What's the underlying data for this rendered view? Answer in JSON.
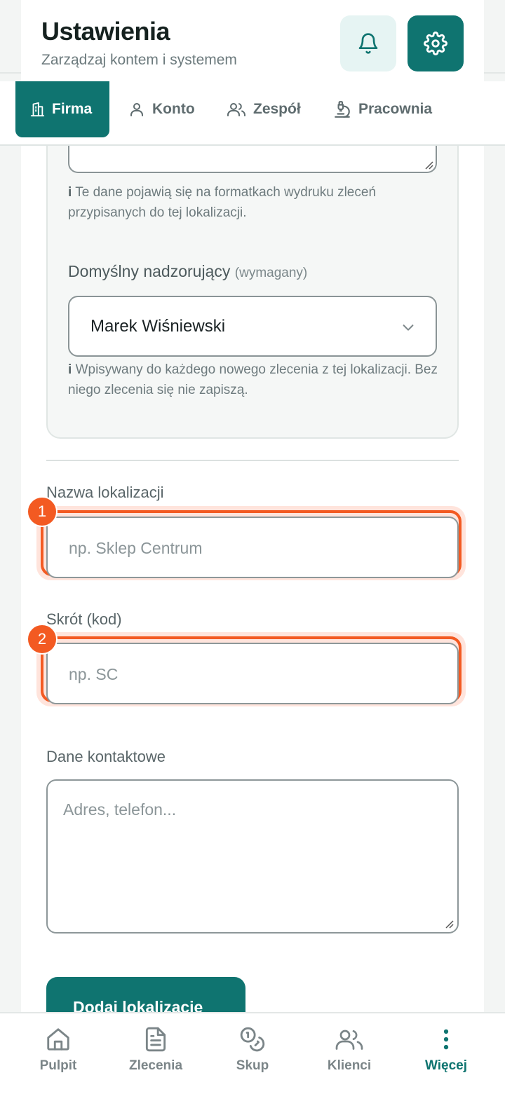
{
  "header": {
    "title": "Ustawienia",
    "subtitle": "Zarządzaj kontem i systemem"
  },
  "tabs": [
    {
      "label": "Firma",
      "icon": "building-icon",
      "active": true
    },
    {
      "label": "Konto",
      "icon": "user-icon",
      "active": false
    },
    {
      "label": "Zespół",
      "icon": "users-icon",
      "active": false
    },
    {
      "label": "Pracownia",
      "icon": "microscope-icon",
      "active": false
    }
  ],
  "location_card": {
    "print_hint": "Te dane pojawią się na formatkach wydruku zleceń przypisanych do tej lokalizacji.",
    "supervisor_label": "Domyślny nadzorujący",
    "supervisor_required": "(wymagany)",
    "supervisor_value": "Marek Wiśniewski",
    "supervisor_hint": "Wpisywany do każdego nowego zlecenia z tej lokalizacji. Bez niego zlecenia się nie zapiszą."
  },
  "form": {
    "name_label": "Nazwa lokalizacji",
    "name_placeholder": "np. Sklep Centrum",
    "code_label": "Skrót (kod)",
    "code_placeholder": "np. SC",
    "contact_label": "Dane kontaktowe",
    "contact_placeholder": "Adres, telefon...",
    "submit_label": "Dodaj lokalizację"
  },
  "annotations": {
    "badge_1": "1",
    "badge_2": "2",
    "highlight_color": "#f35a22"
  },
  "bottom_nav": [
    {
      "label": "Pulpit",
      "icon": "home-icon"
    },
    {
      "label": "Zlecenia",
      "icon": "document-icon"
    },
    {
      "label": "Skup",
      "icon": "coins-icon"
    },
    {
      "label": "Klienci",
      "icon": "clients-icon"
    },
    {
      "label": "Więcej",
      "icon": "more-vertical-icon",
      "active": true
    }
  ],
  "colors": {
    "accent": "#0f7470",
    "accent_light": "#e6f4f3",
    "highlight": "#f35a22"
  }
}
